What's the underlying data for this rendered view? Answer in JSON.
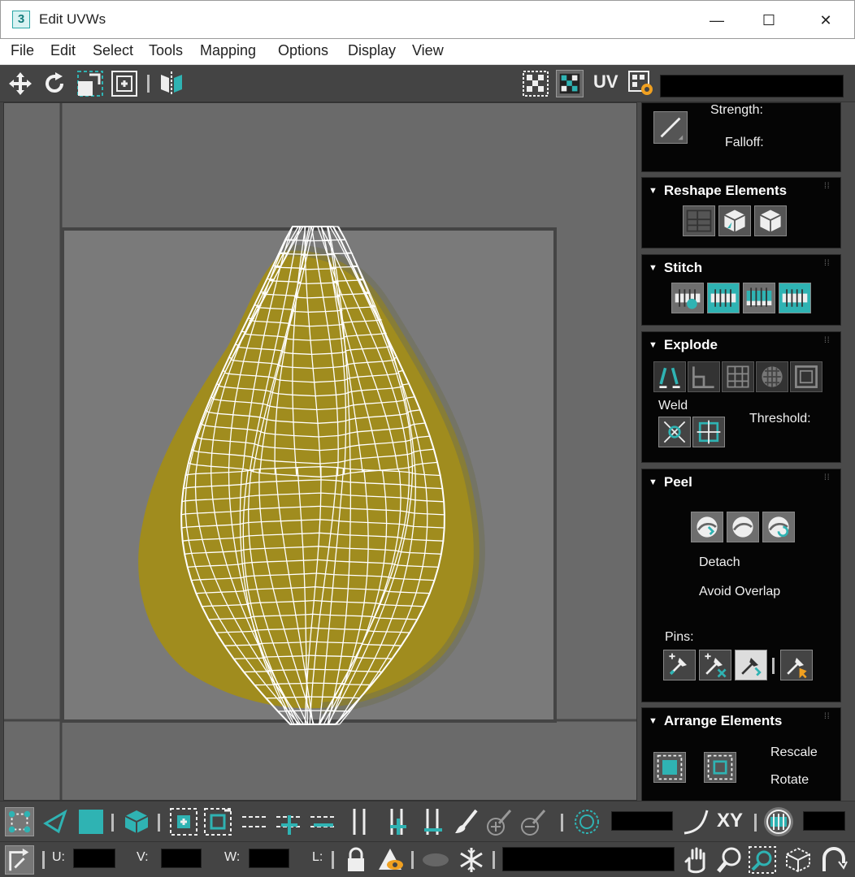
{
  "window": {
    "app_logo": "3",
    "title": "Edit UVWs",
    "minimize": "—",
    "maximize": "☐",
    "close": "✕"
  },
  "menu": [
    "File",
    "Edit",
    "Select",
    "Tools",
    "Mapping",
    "Options",
    "Display",
    "View"
  ],
  "toolbar": {
    "uv_label": "UV"
  },
  "panel": {
    "soft_selection": {
      "strength_label": "Strength:",
      "falloff_label": "Falloff:"
    },
    "reshape": {
      "title": "Reshape Elements"
    },
    "stitch": {
      "title": "Stitch"
    },
    "explode": {
      "title": "Explode",
      "weld_label": "Weld",
      "threshold_label": "Threshold:"
    },
    "peel": {
      "title": "Peel",
      "detach_label": "Detach",
      "avoid_overlap_label": "Avoid Overlap",
      "pins_label": "Pins:"
    },
    "arrange": {
      "title": "Arrange Elements",
      "rescale_label": "Rescale",
      "rotate_label": "Rotate"
    }
  },
  "bottom": {
    "xy_label": "XY",
    "u_label": "U:",
    "v_label": "V:",
    "w_label": "W:",
    "l_label": "L:"
  },
  "colors": {
    "accent": "#2fb3b3",
    "viewport_bg": "#6a6a6a",
    "panel_bg": "#050505",
    "fruit": "#a08c1e"
  }
}
